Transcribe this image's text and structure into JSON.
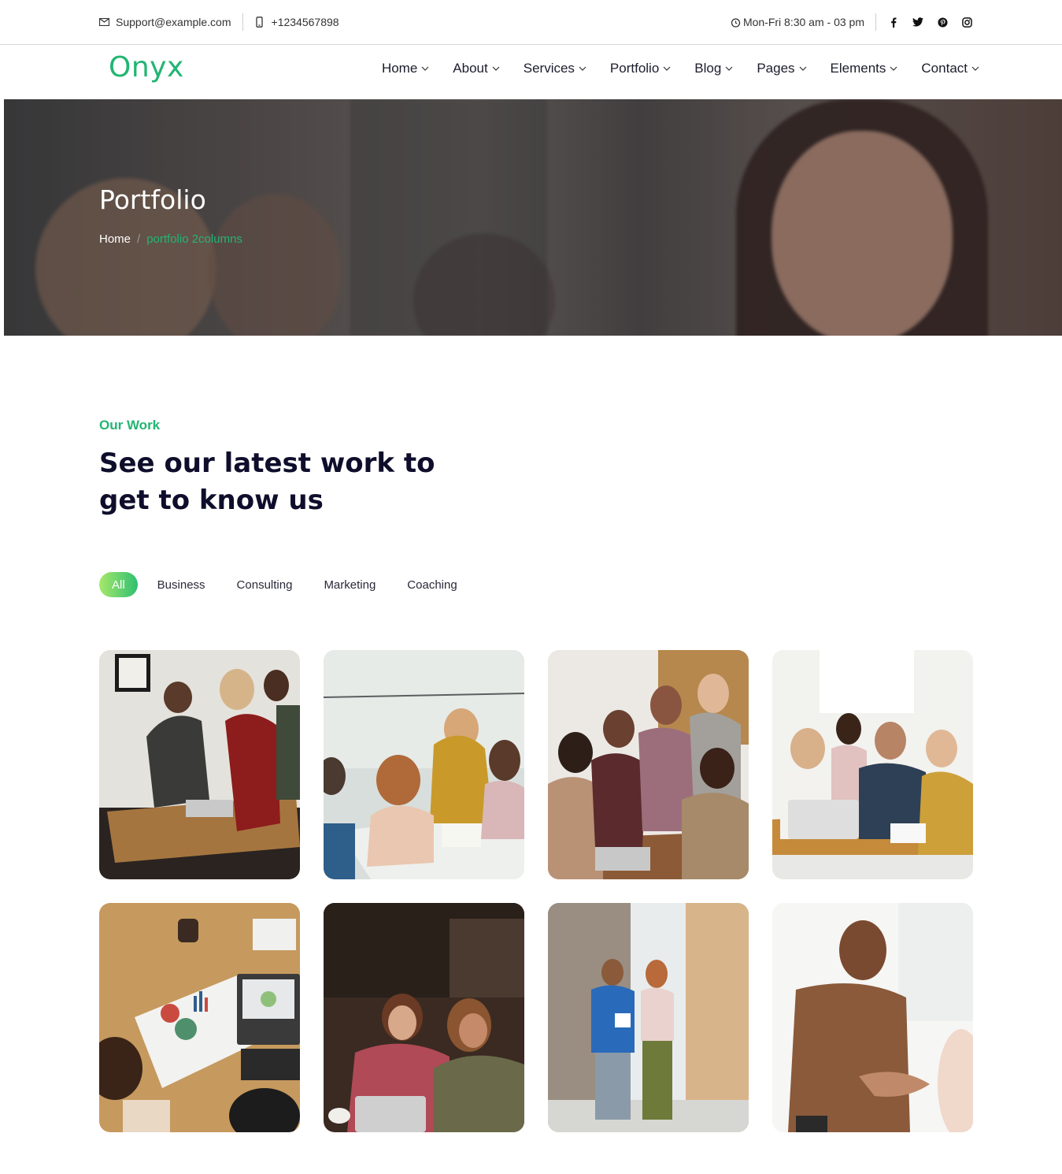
{
  "topbar": {
    "email": "Support@example.com",
    "phone": "+1234567898",
    "hours": "Mon-Fri 8:30 am - 03 pm",
    "social": [
      "facebook-icon",
      "twitter-icon",
      "pinterest-icon",
      "instagram-icon"
    ]
  },
  "brand": {
    "logo": "Onyx",
    "accent": "#22b573"
  },
  "nav": {
    "items": [
      {
        "label": "Home"
      },
      {
        "label": "About"
      },
      {
        "label": "Services"
      },
      {
        "label": "Portfolio"
      },
      {
        "label": "Blog"
      },
      {
        "label": "Pages"
      },
      {
        "label": "Elements"
      },
      {
        "label": "Contact"
      }
    ]
  },
  "hero": {
    "title": "Portfolio",
    "breadcrumb": {
      "home": "Home",
      "separator": "/",
      "current": "portfolio 2columns"
    }
  },
  "section": {
    "eyebrow": "Our Work",
    "heading": "See our latest work to get to know us"
  },
  "filters": [
    {
      "label": "All",
      "active": true
    },
    {
      "label": "Business"
    },
    {
      "label": "Consulting"
    },
    {
      "label": "Marketing"
    },
    {
      "label": "Coaching"
    }
  ],
  "portfolio": [
    {
      "name": "team-planning-photo"
    },
    {
      "name": "group-notebook-photo"
    },
    {
      "name": "team-laptop-photo"
    },
    {
      "name": "cafe-meeting-photo"
    },
    {
      "name": "charts-desk-photo"
    },
    {
      "name": "women-laptop-photo"
    },
    {
      "name": "office-walk-photo"
    },
    {
      "name": "handshake-photo"
    }
  ]
}
